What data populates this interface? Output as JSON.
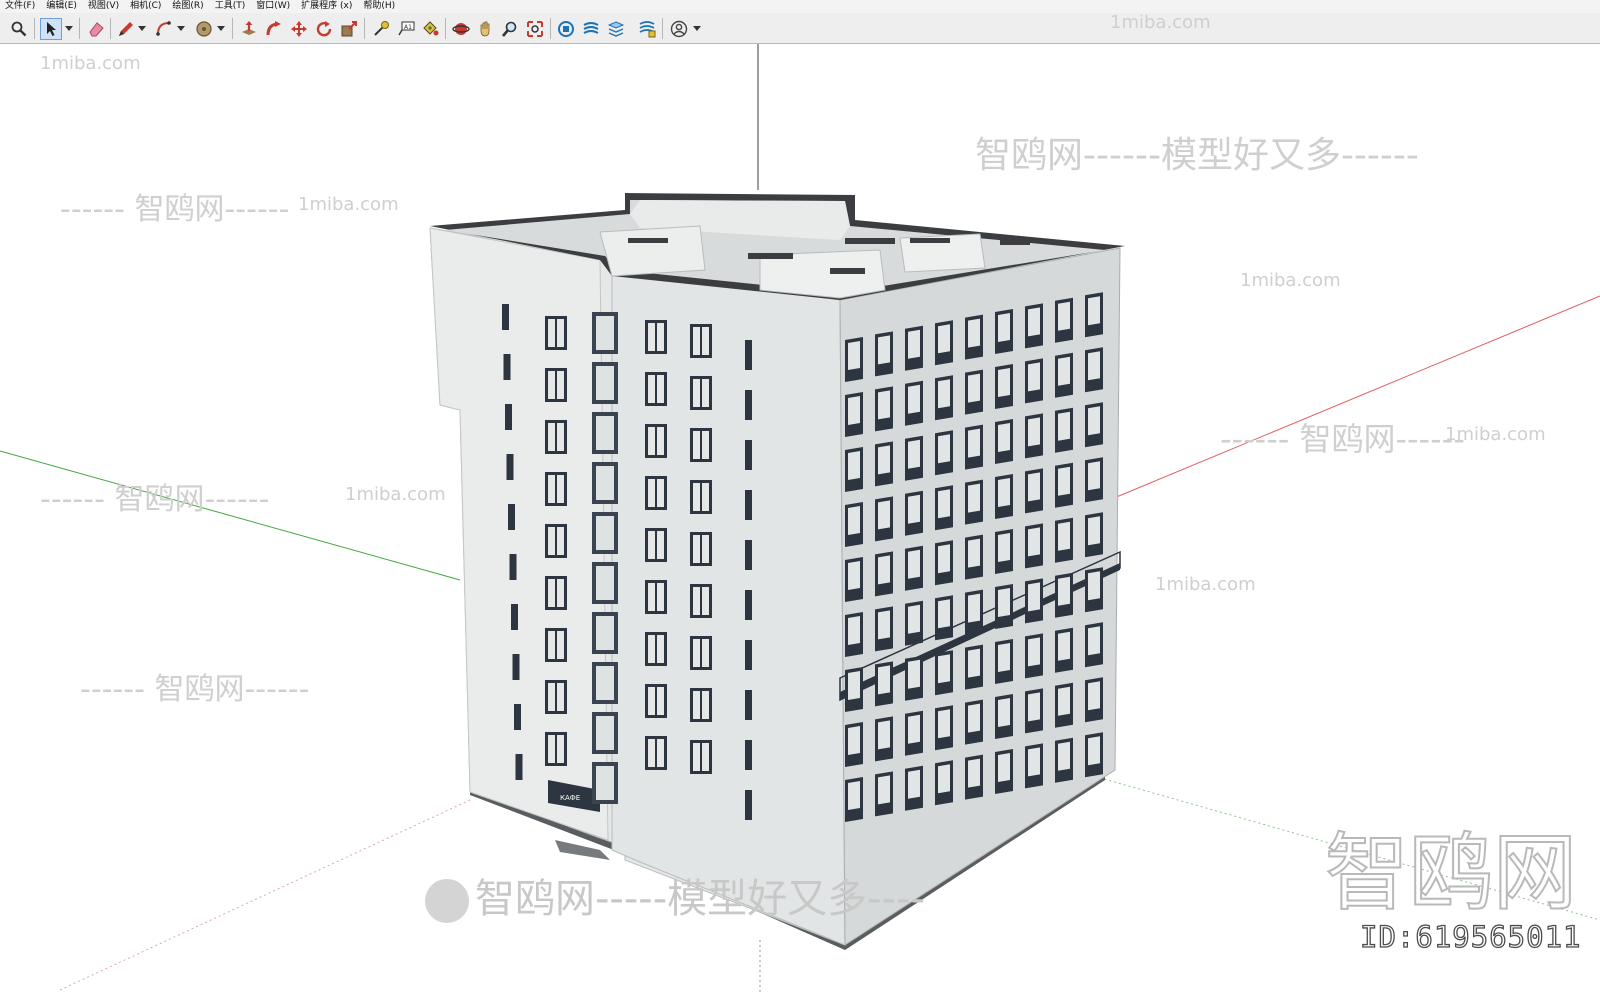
{
  "menu": [
    "文件(F)",
    "编辑(E)",
    "视图(V)",
    "相机(C)",
    "绘图(R)",
    "工具(T)",
    "窗口(W)",
    "扩展程序 (x)",
    "帮助(H)"
  ],
  "toolbar": {
    "tools": [
      "zoom-icon",
      "select-arrow-icon",
      "eraser-icon",
      "pencil-icon",
      "arc-icon",
      "circle-icon",
      "push-pull-icon",
      "follow-me-icon",
      "move-icon",
      "rotate-icon",
      "scale-icon",
      "tape-measure-icon",
      "text-icon",
      "paint-bucket-icon",
      "orbit-icon",
      "pan-icon",
      "zoom-tool-icon",
      "zoom-extents-icon",
      "component-icon",
      "styles-icon",
      "layers-icon",
      "scenes-icon",
      "account-icon"
    ]
  },
  "watermarks": {
    "site": "1miba.com",
    "brand_line_1": "智鸥网------模型好又多------",
    "brand_line_2": "------ 智鸥网------",
    "brand_big": "智鸥网",
    "bottom_line": "智鸥网-----模型好又多----",
    "id_text": "ID:619565011"
  },
  "building_signs": {
    "cafe_sign": "КАФЕ"
  },
  "colors": {
    "menubar_bg": "#f3f3f3",
    "toolbar_bg": "#eeeeee",
    "viewport_bg": "#ffffff",
    "axis_green": "#3fa83f",
    "axis_red": "#e06060",
    "facade": "#e6e8e8",
    "facade_shadow": "#d2d6d6",
    "roof": "#3b3d40",
    "window": "#2c3540"
  }
}
